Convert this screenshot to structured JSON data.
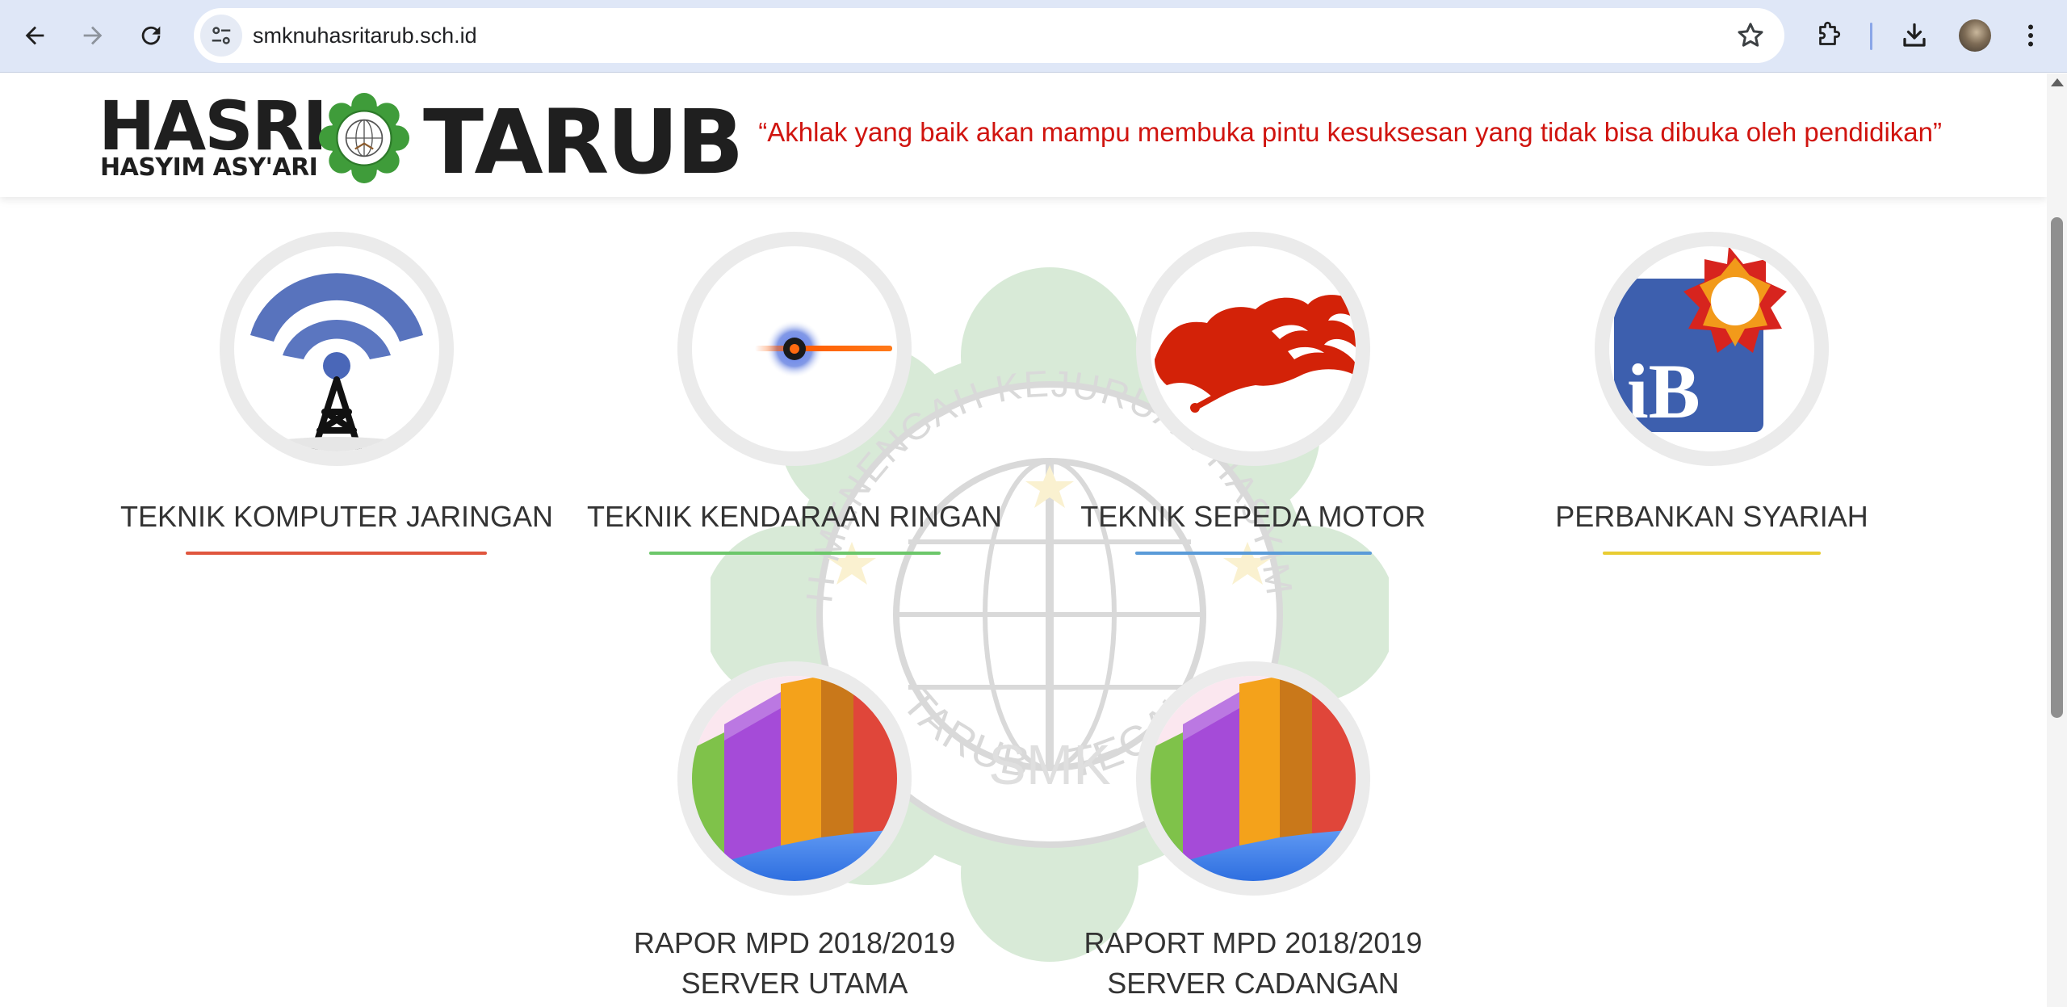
{
  "browser": {
    "url": "smknuhasritarub.sch.id",
    "icons": [
      "back-icon",
      "forward-icon",
      "reload-icon",
      "site-settings-icon",
      "bookmark-star-icon",
      "extensions-icon",
      "download-icon",
      "profile-avatar",
      "more-menu-icon"
    ]
  },
  "header": {
    "logo_hasri": "HASRI",
    "logo_hasyim": "HASYIM ASY'ARI",
    "logo_tarub": "TARUB",
    "tagline": "“Akhlak yang baik akan mampu membuka pintu kesuksesan yang tidak bisa dibuka oleh pendidikan”",
    "tagline_color": "#d0140f"
  },
  "watermark": {
    "top_text": "SEKOLAH MENENGAH KEJURUAN HASYIM ASY'ARI",
    "bottom_text": "TARUB - TEGAL",
    "center_text": "SMK"
  },
  "menu": {
    "tiles": [
      {
        "label": "TEKNIK KOMPUTER JARINGAN",
        "underline_color": "#e0563e",
        "icon": "radio-tower-icon"
      },
      {
        "label": "TEKNIK KENDARAAN RINGAN",
        "underline_color": "#6cc76a",
        "icon": "light-streak-icon"
      },
      {
        "label": "TEKNIK SEPEDA MOTOR",
        "underline_color": "#5a9bd8",
        "icon": "flame-dragon-icon"
      },
      {
        "label": "PERBANKAN SYARIAH",
        "underline_color": "#e9cc32",
        "icon": "ib-logo-icon"
      },
      {
        "label_line1": "RAPOR MPD 2018/2019",
        "label_line2": "SERVER UTAMA",
        "icon": "bar-chart-icon"
      },
      {
        "label_line1": "RAPORT MPD 2018/2019",
        "label_line2": "SERVER CADANGAN",
        "icon": "bar-chart-icon"
      }
    ]
  }
}
